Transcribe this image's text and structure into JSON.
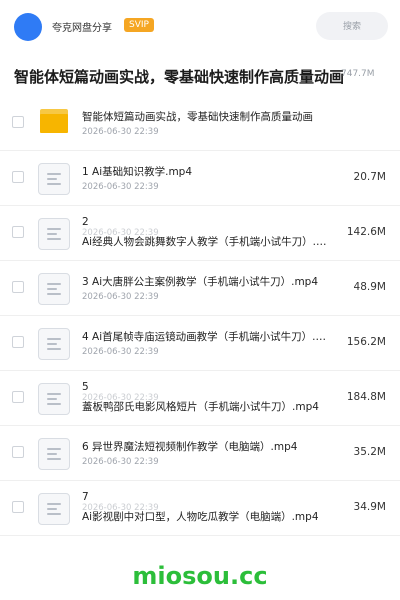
{
  "header": {
    "brand": "夸克网盘分享",
    "badge": "SVIP",
    "search_label": "搜索"
  },
  "folder": {
    "title": "智能体短篇动画实战，零基础快速制作高质量动画",
    "total_size": "747.7M"
  },
  "rows": [
    {
      "icon": "folder-icon",
      "name_line1": "智能体短篇动画实战，零基础快速制作高质量动画",
      "name_line2": "",
      "date": "2026-06-30 22:39",
      "size": ""
    },
    {
      "icon": "video-file-icon",
      "name_line1": "1 Ai基础知识教学.mp4",
      "name_line2": "",
      "date": "2026-06-30 22:39",
      "size": "20.7M"
    },
    {
      "icon": "video-file-icon",
      "name_line1": "2",
      "name_line2": "Ai经典人物会跳舞数字人教学（手机端小试牛刀）.mp4",
      "date": "2026-06-30 22:39",
      "size": "142.6M"
    },
    {
      "icon": "video-file-icon",
      "name_line1": "3 Ai大唐胖公主案例教学（手机端小试牛刀）.mp4",
      "name_line2": "",
      "date": "2026-06-30 22:39",
      "size": "48.9M"
    },
    {
      "icon": "video-file-icon",
      "name_line1": "4 Ai首尾帧寺庙运镜动画教学（手机端小试牛刀）.mp4",
      "name_line2": "",
      "date": "2026-06-30 22:39",
      "size": "156.2M"
    },
    {
      "icon": "video-file-icon",
      "name_line1": "5",
      "name_line2": "蓋板鸭邵氏电影风格短片（手机端小试牛刀）.mp4",
      "date": "2026-06-30 22:39",
      "size": "184.8M"
    },
    {
      "icon": "video-file-icon",
      "name_line1": "6 异世界魔法短视频制作教学（电脑端）.mp4",
      "name_line2": "",
      "date": "2026-06-30 22:39",
      "size": "35.2M"
    },
    {
      "icon": "video-file-icon",
      "name_line1": "7",
      "name_line2": "Ai影视剧中对口型，人物吃瓜教学（电脑端）.mp4",
      "date": "2026-06-30 22:39",
      "size": "34.9M"
    }
  ],
  "watermark": "miosou.cc"
}
